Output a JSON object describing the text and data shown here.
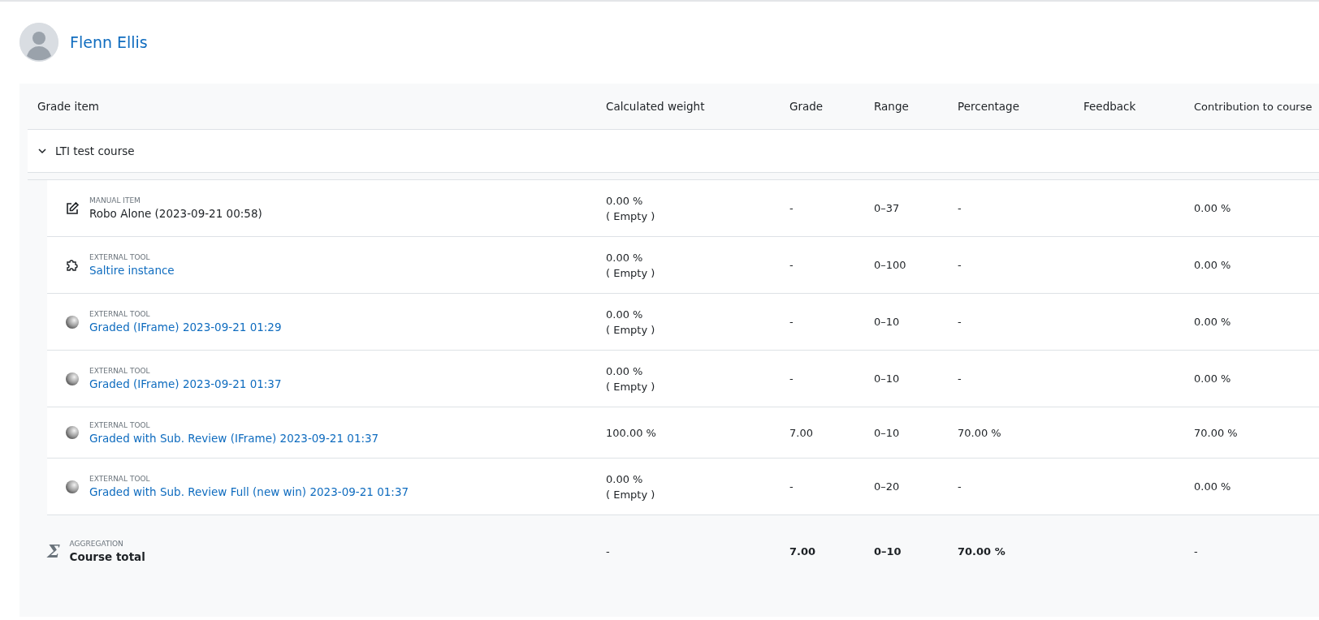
{
  "user": {
    "name": "Flenn Ellis"
  },
  "table": {
    "columns": [
      "Grade item",
      "Calculated weight",
      "Grade",
      "Range",
      "Percentage",
      "Feedback",
      "Contribution to course"
    ],
    "category": {
      "name": "LTI test course",
      "expanded": true
    },
    "rows": [
      {
        "kind": "manual",
        "type_label": "MANUAL ITEM",
        "name": "Robo Alone (2023-09-21 00:58)",
        "weight": "0.00 %",
        "weight_note": "( Empty )",
        "grade": "-",
        "range": "0–37",
        "percentage": "-",
        "contribution": "0.00 %"
      },
      {
        "kind": "lti",
        "type_label": "EXTERNAL TOOL",
        "name": "Saltire instance",
        "weight": "0.00 %",
        "weight_note": "( Empty )",
        "grade": "-",
        "range": "0–100",
        "percentage": "-",
        "contribution": "0.00 %"
      },
      {
        "kind": "tool",
        "type_label": "EXTERNAL TOOL",
        "name": "Graded (IFrame) 2023-09-21 01:29",
        "weight": "0.00 %",
        "weight_note": "( Empty )",
        "grade": "-",
        "range": "0–10",
        "percentage": "-",
        "contribution": "0.00 %"
      },
      {
        "kind": "tool",
        "type_label": "EXTERNAL TOOL",
        "name": "Graded (IFrame) 2023-09-21 01:37",
        "weight": "0.00 %",
        "weight_note": "( Empty )",
        "grade": "-",
        "range": "0–10",
        "percentage": "-",
        "contribution": "0.00 %"
      },
      {
        "kind": "tool",
        "type_label": "EXTERNAL TOOL",
        "name": "Graded with Sub. Review (IFrame) 2023-09-21 01:37",
        "weight": "100.00 %",
        "grade": "7.00",
        "range": "0–10",
        "percentage": "70.00 %",
        "contribution": "70.00 %"
      },
      {
        "kind": "tool",
        "type_label": "EXTERNAL TOOL",
        "name": "Graded with Sub. Review Full (new win) 2023-09-21 01:37",
        "weight": "0.00 %",
        "weight_note": "( Empty )",
        "grade": "-",
        "range": "0–20",
        "percentage": "-",
        "contribution": "0.00 %"
      }
    ],
    "total": {
      "symbol": "Σ",
      "type_label": "AGGREGATION",
      "name": "Course total",
      "weight": "-",
      "grade": "7.00",
      "range": "0–10",
      "percentage": "70.00 %",
      "contribution": "-"
    }
  }
}
